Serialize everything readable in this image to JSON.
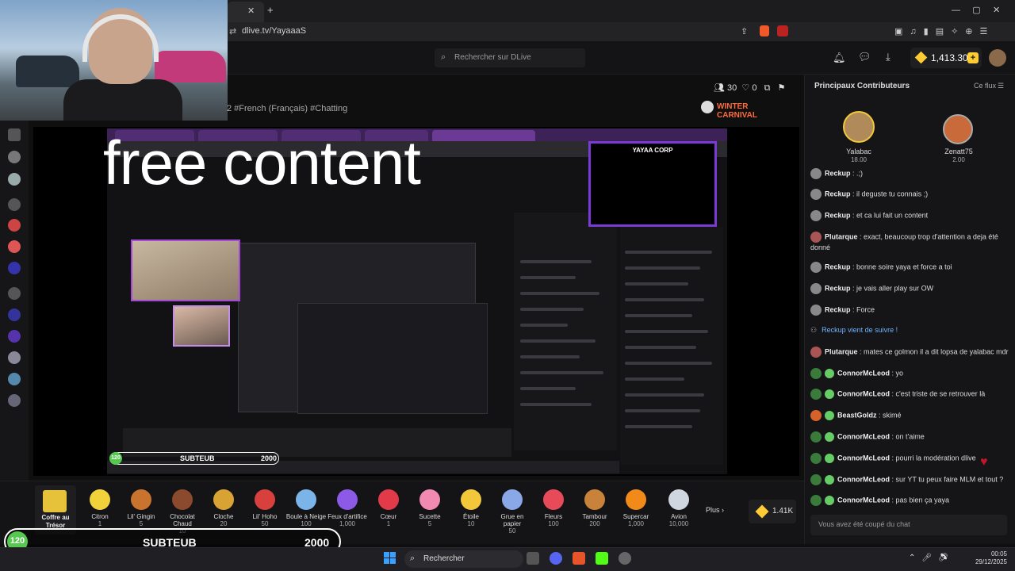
{
  "browser": {
    "url": "dlive.tv/YayaaaS",
    "tab_close": "✕",
    "new_tab": "+"
  },
  "header": {
    "search_placeholder": "Rechercher sur DLive",
    "balance": "1,413.30"
  },
  "stream": {
    "tags": "2  #French (Français)  #Chatting",
    "viewers": "30",
    "likes": "0",
    "event_badge": "WINTER CARNIVAL",
    "overlay_text": "free content",
    "corp_label": "YAYAA CORP"
  },
  "right_panel": {
    "title": "Principaux Contributeurs",
    "filter": "Ce flux",
    "contributors": [
      {
        "name": "Yalabac",
        "amount": "18.00"
      },
      {
        "name": "Zenatt75",
        "amount": "2.00"
      }
    ],
    "chat": [
      {
        "user": "Reckup",
        "text": ": .;)"
      },
      {
        "user": "Reckup",
        "text": ": il deguste tu connais ;)"
      },
      {
        "user": "Reckup",
        "text": ": et ca lui fait un content"
      },
      {
        "user": "Plutarque",
        "text": ": exact, beaucoup trop d'attention a deja été donné"
      },
      {
        "user": "Reckup",
        "text": ": bonne soire yaya et force a toi"
      },
      {
        "user": "Reckup",
        "text": ": je vais aller play sur OW"
      },
      {
        "user": "Reckup",
        "text": ": Force"
      },
      {
        "user": "",
        "text": "Reckup vient de suivre !"
      },
      {
        "user": "Plutarque",
        "text": ": mates ce golmon il a dit lopsa de yalabac mdr"
      },
      {
        "user": "ConnorMcLeod",
        "text": ": yo"
      },
      {
        "user": "ConnorMcLeod",
        "text": ": c'est triste de se retrouver là"
      },
      {
        "user": "BeastGoldz",
        "text": ": skimé"
      },
      {
        "user": "ConnorMcLeod",
        "text": ": on t'aime"
      },
      {
        "user": "ConnorMcLeod",
        "text": ": pourri la modération dlive"
      },
      {
        "user": "ConnorMcLeod",
        "text": ": sur YT tu peux faire MLM et tout ?"
      },
      {
        "user": "ConnorMcLeod",
        "text": ": pas bien ça yaya"
      }
    ],
    "banned_notice": "Vous avez été coupé du chat"
  },
  "gifts": {
    "chest_label": "Coffre au Trésor",
    "items": [
      {
        "name": "Citron",
        "price": "1",
        "color": "#f2d23a"
      },
      {
        "name": "Lil' Gingin",
        "price": "5",
        "color": "#c9742e"
      },
      {
        "name": "Chocolat Chaud",
        "price": "10",
        "color": "#8a4a2b"
      },
      {
        "name": "Cloche",
        "price": "20",
        "color": "#d9a334"
      },
      {
        "name": "Lil' Hoho",
        "price": "50",
        "color": "#d8403e"
      },
      {
        "name": "Boule à Neige",
        "price": "100",
        "color": "#7ab4e8"
      },
      {
        "name": "Feux d'artifice",
        "price": "1,000",
        "color": "#8d5ae8"
      },
      {
        "name": "Cœur",
        "price": "1",
        "color": "#e33a4a"
      },
      {
        "name": "Sucette",
        "price": "5",
        "color": "#f08ab0"
      },
      {
        "name": "Étoile",
        "price": "10",
        "color": "#f2c73a"
      },
      {
        "name": "Grue en papier",
        "price": "50",
        "color": "#8aa8e8"
      },
      {
        "name": "Fleurs",
        "price": "100",
        "color": "#e84a5a"
      },
      {
        "name": "Tambour",
        "price": "200",
        "color": "#c9823a"
      },
      {
        "name": "Supercar",
        "price": "1,000",
        "color": "#f28a1a"
      },
      {
        "name": "Avion",
        "price": "10,000",
        "color": "#cfd6df"
      }
    ],
    "more_label": "Plus",
    "gems": "1.41K"
  },
  "subgoal": {
    "count": "120",
    "label": "SUBTEUB",
    "target": "2000"
  },
  "taskbar": {
    "search": "Rechercher",
    "time": "00:05",
    "date": "29/12/2025"
  }
}
